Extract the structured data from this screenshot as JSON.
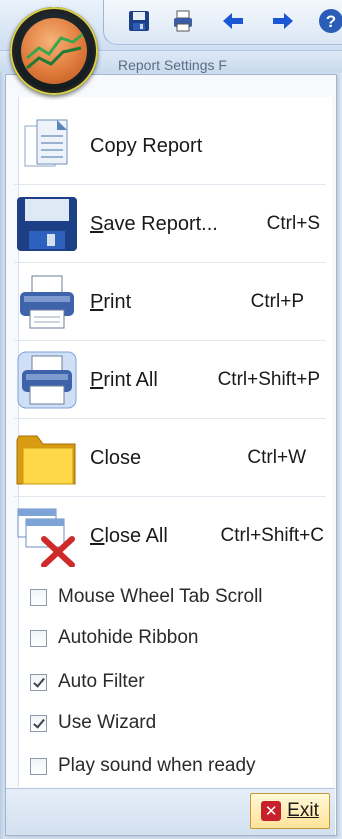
{
  "quick_access": {
    "buttons": [
      {
        "icon": "save-icon"
      },
      {
        "icon": "print-icon"
      },
      {
        "icon": "arrow-left-icon"
      },
      {
        "icon": "arrow-right-icon"
      },
      {
        "icon": "help-icon"
      }
    ],
    "help_glyph": "?"
  },
  "ribbon_ghost_text": "Report Settings     F",
  "menu": {
    "items": [
      {
        "label": "Copy Report",
        "mnemonic": "",
        "rest": "Copy Report",
        "shortcut": "",
        "icon": "copy-report-icon"
      },
      {
        "label": "Save Report...",
        "mnemonic": "S",
        "rest": "ave Report...",
        "shortcut": "Ctrl+S",
        "icon": "save-report-icon"
      },
      {
        "label": "Print",
        "mnemonic": "P",
        "rest": "rint",
        "shortcut": "Ctrl+P",
        "icon": "printer-icon"
      },
      {
        "label": "Print All",
        "mnemonic": "P",
        "rest": "rint All",
        "shortcut": "Ctrl+Shift+P",
        "icon": "print-all-icon"
      },
      {
        "label": "Close",
        "mnemonic": "",
        "rest": "Close",
        "shortcut": "Ctrl+W",
        "icon": "folder-icon"
      },
      {
        "label": "Close All",
        "mnemonic": "C",
        "rest": "lose All",
        "shortcut": "Ctrl+Shift+C",
        "icon": "close-all-icon"
      }
    ],
    "options": [
      {
        "label": "Mouse Wheel Tab Scroll",
        "checked": false
      },
      {
        "label": "Autohide Ribbon",
        "checked": false
      },
      {
        "label": "Auto Filter",
        "checked": true
      },
      {
        "label": "Use Wizard",
        "checked": true
      },
      {
        "label": "Play sound when ready",
        "checked": false
      }
    ],
    "exit": {
      "label": "Exit",
      "mnemonic": "E",
      "rest": "xit",
      "icon_glyph": "✕"
    }
  },
  "colors": {
    "accent": "#1f4f9c",
    "exit_icon": "#c8202a",
    "orb": "#e07b3c"
  }
}
